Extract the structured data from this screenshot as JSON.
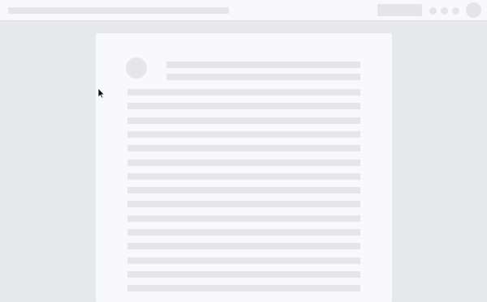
{
  "window": {
    "state": "loading-skeleton"
  },
  "topbar": {
    "title_placeholder": "",
    "action_placeholder": "",
    "window_dots": [
      "dot",
      "dot",
      "dot"
    ],
    "avatar_icon": "user-avatar-icon"
  },
  "document": {
    "avatar_icon": "user-avatar-icon",
    "header_lines": [
      "",
      ""
    ],
    "body_lines": [
      "",
      "",
      "",
      "",
      "",
      "",
      "",
      "",
      "",
      "",
      "",
      "",
      "",
      "",
      ""
    ]
  },
  "cursor": {
    "icon": "mouse-pointer-icon"
  },
  "colors": {
    "background": "#e7e8ec",
    "surface": "#f9f9fb",
    "skeleton": "#e5e5e9"
  }
}
